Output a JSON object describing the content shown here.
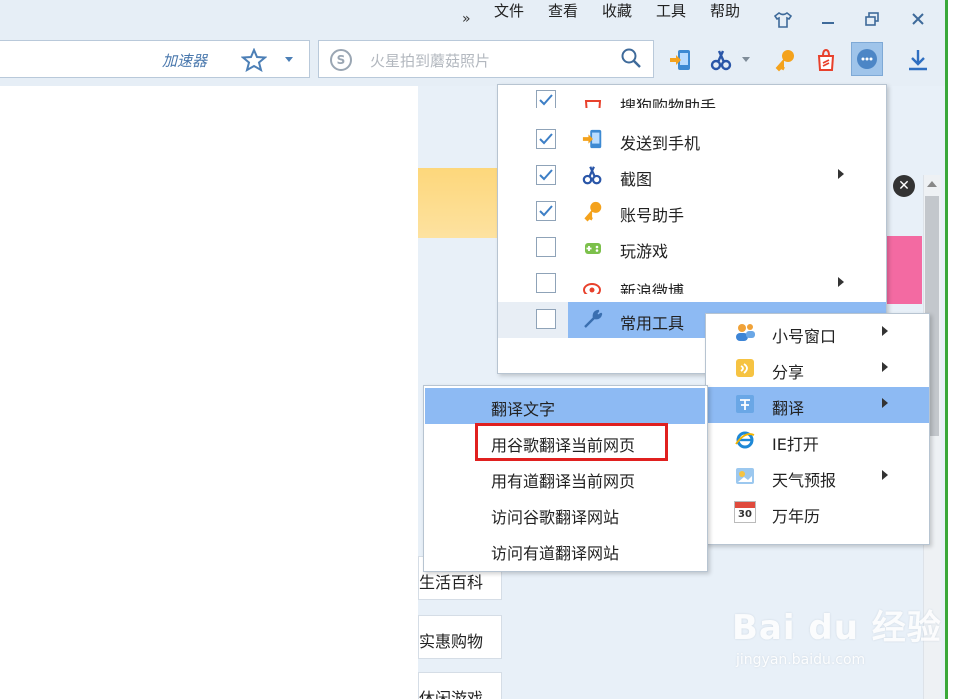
{
  "menubar": {
    "chevron": "»",
    "items": [
      "文件",
      "查看",
      "收藏",
      "工具",
      "帮助"
    ],
    "window_controls": [
      "shirt-icon",
      "minimize-icon",
      "restore-icon",
      "close-icon"
    ]
  },
  "toolbar": {
    "accelerator_label": "加速器",
    "search_placeholder": "火星拍到蘑菇照片",
    "icons": [
      "send-to-phone-icon",
      "screenshot-scissors-icon",
      "key-icon",
      "shopping-bag-icon",
      "more-icon",
      "download-icon"
    ]
  },
  "content": {
    "links": [
      "生活百科",
      "实惠购物",
      "休闲游戏"
    ]
  },
  "menu_main": {
    "items": [
      {
        "label": "搜狗购物助手",
        "checked": true,
        "icon": "shopping-bag-icon",
        "has_submenu": false
      },
      {
        "label": "发送到手机",
        "checked": true,
        "icon": "send-to-phone-icon",
        "has_submenu": false
      },
      {
        "label": "截图",
        "checked": true,
        "icon": "scissors-icon",
        "has_submenu": true
      },
      {
        "label": "账号助手",
        "checked": true,
        "icon": "key-icon",
        "has_submenu": false
      },
      {
        "label": "玩游戏",
        "checked": false,
        "icon": "gamepad-icon",
        "has_submenu": false
      },
      {
        "label": "新浪微博",
        "checked": false,
        "icon": "weibo-icon",
        "has_submenu": true
      },
      {
        "label": "常用工具",
        "checked": false,
        "icon": "wrench-icon",
        "has_submenu": true,
        "highlighted": true
      }
    ]
  },
  "menu_tools": {
    "items": [
      {
        "label": "小号窗口",
        "icon": "users-icon",
        "has_submenu": true
      },
      {
        "label": "分享",
        "icon": "share-icon",
        "has_submenu": true
      },
      {
        "label": "翻译",
        "icon": "translate-icon",
        "has_submenu": true,
        "highlighted": true
      },
      {
        "label": "IE打开",
        "icon": "ie-icon",
        "has_submenu": false
      },
      {
        "label": "天气预报",
        "icon": "weather-icon",
        "has_submenu": true
      },
      {
        "label": "万年历",
        "icon": "calendar-icon",
        "has_submenu": false
      }
    ],
    "calendar_day": "30"
  },
  "menu_translate": {
    "items": [
      {
        "label": "翻译文字",
        "highlighted": true
      },
      {
        "label": "用谷歌翻译当前网页",
        "outlined": true
      },
      {
        "label": "用有道翻译当前网页"
      },
      {
        "label": "访问谷歌翻译网站"
      },
      {
        "label": "访问有道翻译网站"
      }
    ]
  },
  "watermark": {
    "main": "Bai du 经验",
    "sub": "jingyan.baidu.com"
  },
  "colors": {
    "highlight": "#8dbaf3",
    "outline": "#e0201f",
    "chrome_bg": "#e6eef6",
    "accent_blue": "#4c7fb6"
  }
}
